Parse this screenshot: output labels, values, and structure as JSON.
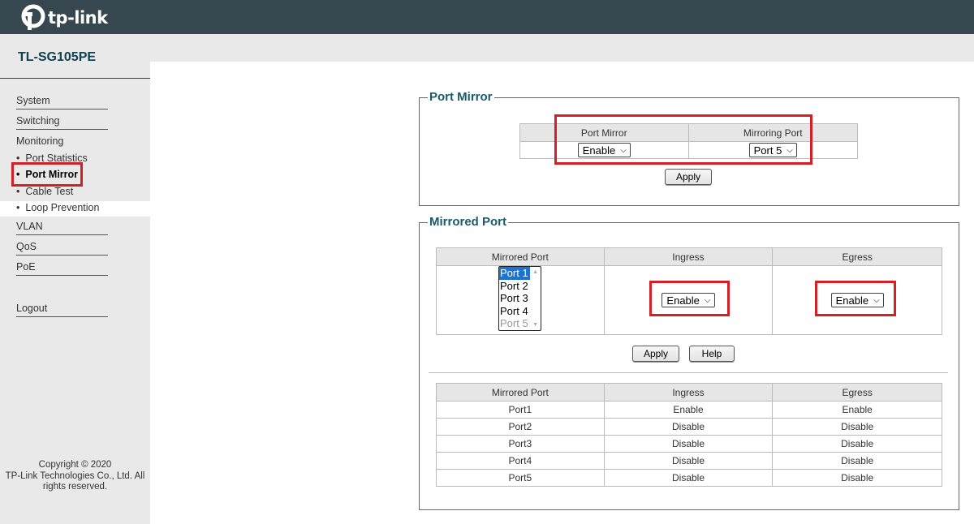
{
  "header": {
    "brand": "tp-link",
    "colors": {
      "bar": "#37474f",
      "highlight": "#d32027"
    }
  },
  "sidebar": {
    "model": "TL-SG105PE",
    "items": [
      {
        "label": "System"
      },
      {
        "label": "Switching"
      },
      {
        "label": "Monitoring"
      },
      {
        "label": "Port Statistics"
      },
      {
        "label": "Port Mirror"
      },
      {
        "label": "Cable Test"
      },
      {
        "label": "Loop Prevention"
      },
      {
        "label": "VLAN"
      },
      {
        "label": "QoS"
      },
      {
        "label": "PoE"
      },
      {
        "label": "Logout"
      }
    ],
    "copyright": [
      "Copyright © 2020",
      "TP-Link Technologies Co., Ltd. All",
      "rights reserved."
    ]
  },
  "port_mirror": {
    "legend": "Port Mirror",
    "col_mirror": "Port Mirror",
    "col_mirroring": "Mirroring Port",
    "mirror_value": "Enable",
    "mirroring_value": "Port 5",
    "apply": "Apply"
  },
  "mirrored_port": {
    "legend": "Mirrored Port",
    "col_port": "Mirrored Port",
    "col_ingress": "Ingress",
    "col_egress": "Egress",
    "ports": [
      "Port 1",
      "Port 2",
      "Port 3",
      "Port 4",
      "Port 5"
    ],
    "selected_port": "Port 1",
    "ingress_value": "Enable",
    "egress_value": "Enable",
    "apply": "Apply",
    "help": "Help",
    "table_headers": [
      "Mirrored Port",
      "Ingress",
      "Egress"
    ],
    "rows": [
      [
        "Port1",
        "Enable",
        "Enable"
      ],
      [
        "Port2",
        "Disable",
        "Disable"
      ],
      [
        "Port3",
        "Disable",
        "Disable"
      ],
      [
        "Port4",
        "Disable",
        "Disable"
      ],
      [
        "Port5",
        "Disable",
        "Disable"
      ]
    ]
  }
}
